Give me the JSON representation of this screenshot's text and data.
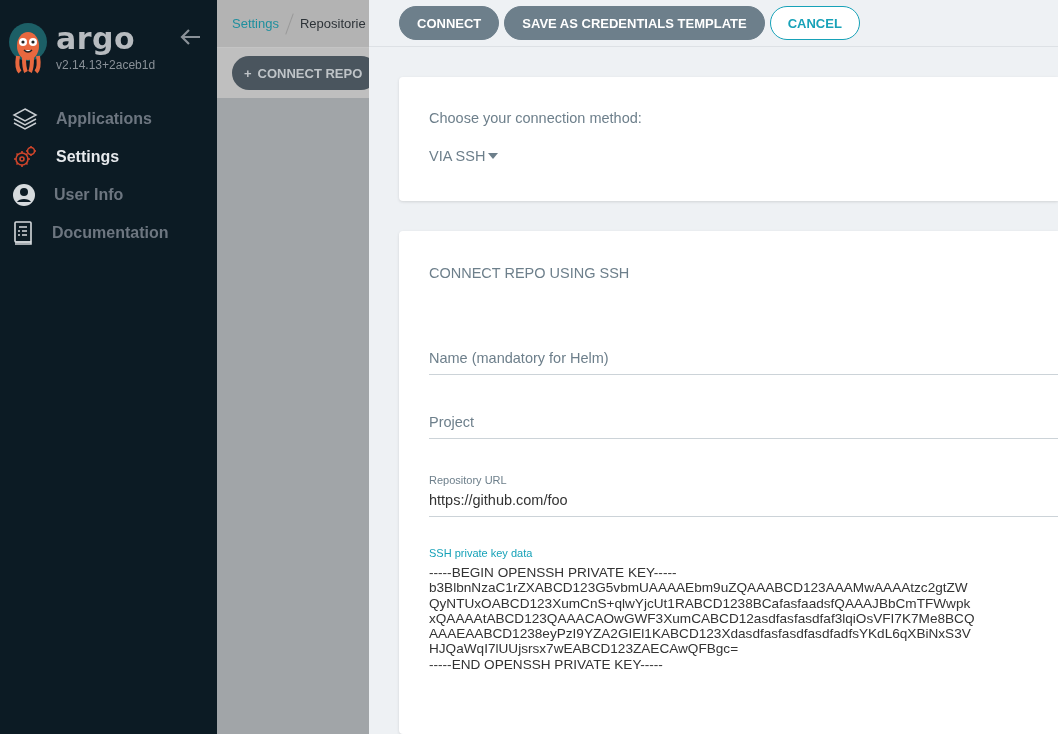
{
  "sidebar": {
    "logo_text": "argo",
    "version": "v2.14.13+2aceb1d",
    "items": [
      {
        "label": "Applications",
        "selected": false
      },
      {
        "label": "Settings",
        "selected": true
      },
      {
        "label": "User Info",
        "selected": false
      },
      {
        "label": "Documentation",
        "selected": false
      }
    ]
  },
  "breadcrumbs": [
    {
      "label": "Settings",
      "link": true
    },
    {
      "label": "Repositorie",
      "link": false
    }
  ],
  "page_action": {
    "icon": "+",
    "label": "CONNECT REPO"
  },
  "panel": {
    "buttons": [
      {
        "label": "CONNECT",
        "kind": "filled"
      },
      {
        "label": "SAVE AS CREDENTIALS TEMPLATE",
        "kind": "filled"
      },
      {
        "label": "CANCEL",
        "kind": "outline"
      }
    ],
    "method_card": {
      "prompt": "Choose your connection method:",
      "method": "VIA SSH"
    },
    "form": {
      "title": "CONNECT REPO USING SSH",
      "fields": [
        {
          "kind": "input",
          "placeholder": "Name (mandatory for Helm)",
          "focused": false
        },
        {
          "kind": "input",
          "placeholder": "Project",
          "focused": false
        },
        {
          "kind": "input",
          "label": "Repository URL",
          "value": "https://github.com/foo",
          "focused": false
        },
        {
          "kind": "textarea",
          "label": "SSH private key data",
          "focused": true,
          "value": "-----BEGIN OPENSSH PRIVATE KEY-----\nb3BlbnNzaC1rZXABCD123G5vbmUAAAAEbm9uZQAAABCD123AAAMwAAAAtzc2gtZW\nQyNTUxOABCD123XumCnS+qlwYjcUt1RABCD1238BCafasfaadsfQAAAJBbCmTFWwpk\nxQAAAAtABCD123QAAACAOwGWF3XumCABCD12asdfasfasdfaf3lqiOsVFI7K7Me8BCQ\nAAAEAABCD1238eyPzI9YZA2GIEl1KABCD123XdasdfasfasdfasdfadfsYKdL6qXBiNxS3V\nHJQaWqI7lUUjsrsx7wEABCD123ZAECAwQFBgc=\n-----END OPENSSH PRIVATE KEY-----"
        }
      ]
    }
  }
}
